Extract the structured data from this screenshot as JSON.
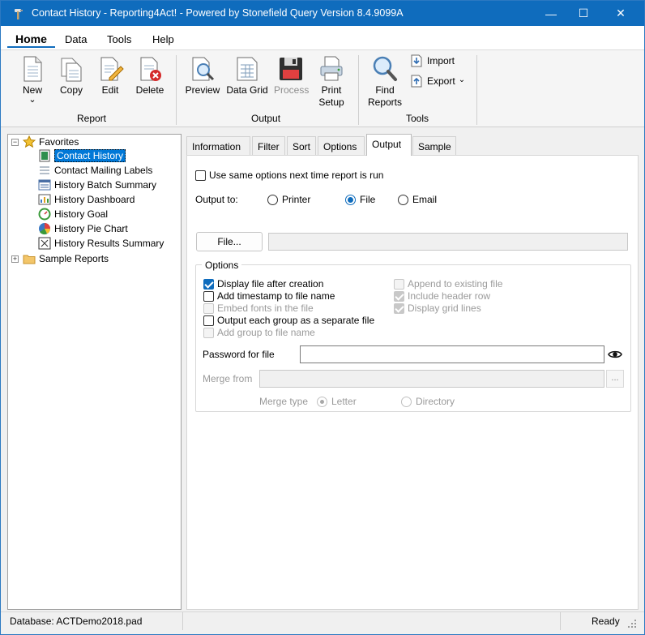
{
  "window": {
    "title": "Contact History - Reporting4Act! - Powered by Stonefield Query Version 8.4.9099A",
    "minimize_glyph": "—",
    "maximize_glyph": "☐",
    "close_glyph": "✕"
  },
  "menu": {
    "items": [
      {
        "label": "Home"
      },
      {
        "label": "Data"
      },
      {
        "label": "Tools"
      },
      {
        "label": "Help"
      }
    ]
  },
  "ribbon": {
    "report_group": {
      "label": "Report",
      "buttons": [
        {
          "label": "New",
          "icon": "new-document-icon"
        },
        {
          "label": "Copy",
          "icon": "copy-icon"
        },
        {
          "label": "Edit",
          "icon": "edit-icon"
        },
        {
          "label": "Delete",
          "icon": "delete-icon"
        }
      ],
      "new_chevron": "⌄"
    },
    "output_group": {
      "label": "Output",
      "buttons": [
        {
          "label": "Preview",
          "icon": "preview-icon"
        },
        {
          "label": "Data Grid",
          "icon": "data-grid-icon"
        },
        {
          "label": "Process",
          "icon": "floppy-disk-icon",
          "disabled": true
        },
        {
          "label": "Print\nSetup",
          "line1": "Print",
          "line2": "Setup",
          "icon": "printer-icon"
        }
      ]
    },
    "tools_group": {
      "label": "Tools",
      "find": {
        "line1": "Find",
        "line2": "Reports",
        "icon": "find-icon"
      },
      "import": {
        "label": "Import",
        "icon": "import-icon"
      },
      "export": {
        "label": "Export",
        "chevron": "⌄",
        "icon": "export-icon"
      }
    }
  },
  "tree": {
    "favorites": {
      "label": "Favorites",
      "toggle": "−"
    },
    "items": [
      {
        "label": "Contact History",
        "selected": true,
        "icon": "report-green-icon"
      },
      {
        "label": "Contact Mailing Labels",
        "icon": "labels-icon"
      },
      {
        "label": "History Batch Summary",
        "icon": "batch-report-icon"
      },
      {
        "label": "History Dashboard",
        "icon": "dashboard-icon"
      },
      {
        "label": "History Goal",
        "icon": "goal-gauge-icon"
      },
      {
        "label": "History Pie Chart",
        "icon": "pie-chart-icon"
      },
      {
        "label": "History Results Summary",
        "icon": "results-summary-icon"
      }
    ],
    "sample_reports": {
      "label": "Sample Reports",
      "toggle": "+"
    }
  },
  "tabs": [
    {
      "label": "Information"
    },
    {
      "label": "Filter"
    },
    {
      "label": "Sort"
    },
    {
      "label": "Options"
    },
    {
      "label": "Output",
      "active": true
    },
    {
      "label": "Sample"
    }
  ],
  "output": {
    "use_same_options": {
      "label": "Use same options next time report is run",
      "checked": false
    },
    "output_to_label": "Output to:",
    "destinations": [
      {
        "label": "Printer",
        "selected": false
      },
      {
        "label": "File",
        "selected": true
      },
      {
        "label": "Email",
        "selected": false
      }
    ],
    "file_button": "File...",
    "file_path": "",
    "options_legend": "Options",
    "left_options": [
      {
        "label": "Display file after creation",
        "checked": true,
        "enabled": true
      },
      {
        "label": "Add timestamp to file name",
        "checked": false,
        "enabled": true
      },
      {
        "label": "Embed fonts in the file",
        "checked": false,
        "enabled": false
      },
      {
        "label": "Output each group as a separate file",
        "checked": false,
        "enabled": true
      },
      {
        "label": "Add group to file name",
        "checked": false,
        "enabled": false
      }
    ],
    "right_options": [
      {
        "label": "Append to existing file",
        "checked": false,
        "enabled": false
      },
      {
        "label": "Include header row",
        "checked": true,
        "enabled": false
      },
      {
        "label": "Display grid lines",
        "checked": true,
        "enabled": false
      }
    ],
    "password_label": "Password for file",
    "password_value": "",
    "merge_from_label": "Merge from",
    "merge_from_value": "",
    "merge_browse": "...",
    "merge_type_label": "Merge type",
    "merge_types": [
      {
        "label": "Letter",
        "selected": true
      },
      {
        "label": "Directory",
        "selected": false
      }
    ]
  },
  "status": {
    "database": "Database: ACTDemo2018.pad",
    "state": "Ready"
  },
  "colors": {
    "accent": "#0f6cbd",
    "selection": "#0078d7"
  }
}
